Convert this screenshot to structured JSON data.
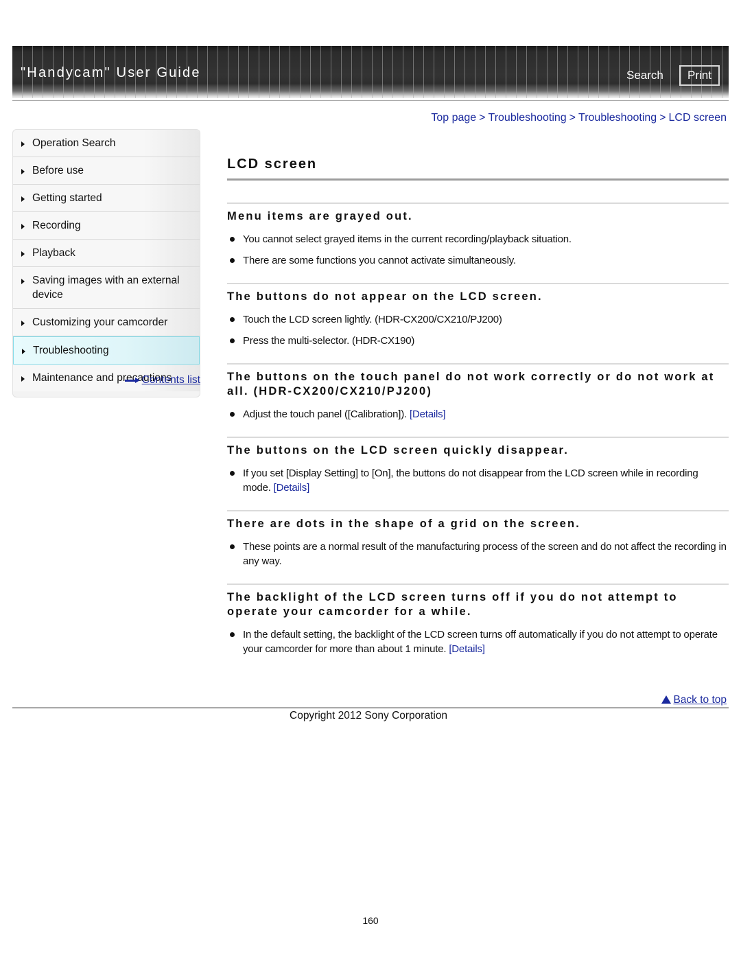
{
  "header": {
    "title": "\"Handycam\" User Guide",
    "search_label": "Search",
    "print_label": "Print"
  },
  "breadcrumb": [
    {
      "label": "Top page"
    },
    {
      "label": "Troubleshooting"
    },
    {
      "label": "Troubleshooting"
    },
    {
      "label": "LCD screen"
    }
  ],
  "breadcrumb_separator": ">",
  "sidebar": {
    "items": [
      {
        "label": "Operation Search",
        "active": false
      },
      {
        "label": "Before use",
        "active": false
      },
      {
        "label": "Getting started",
        "active": false
      },
      {
        "label": "Recording",
        "active": false
      },
      {
        "label": "Playback",
        "active": false
      },
      {
        "label": "Saving images with an external device",
        "active": false
      },
      {
        "label": "Customizing your camcorder",
        "active": false
      },
      {
        "label": "Troubleshooting",
        "active": true
      },
      {
        "label": "Maintenance and precautions",
        "active": false
      }
    ],
    "contents_link": "Contents list"
  },
  "main": {
    "title": "LCD screen",
    "sections": [
      {
        "heading": "Menu items are grayed out.",
        "bullets": [
          {
            "text": "You cannot select grayed items in the current recording/playback situation.",
            "link": ""
          },
          {
            "text": "There are some functions you cannot activate simultaneously.",
            "link": ""
          }
        ]
      },
      {
        "heading": "The buttons do not appear on the LCD screen.",
        "bullets": [
          {
            "text": "Touch the LCD screen lightly. (HDR-CX200/CX210/PJ200)",
            "link": ""
          },
          {
            "text": "Press the multi-selector. (HDR-CX190)",
            "link": ""
          }
        ]
      },
      {
        "heading": "The buttons on the touch panel do not work correctly or do not work at all. (HDR-CX200/CX210/PJ200)",
        "bullets": [
          {
            "text": "Adjust the touch panel ([Calibration]).",
            "link": "[Details]"
          }
        ]
      },
      {
        "heading": "The buttons on the LCD screen quickly disappear.",
        "bullets": [
          {
            "text": "If you set [Display Setting] to [On], the buttons do not disappear from the LCD screen while in recording mode.",
            "link": "[Details]"
          }
        ]
      },
      {
        "heading": "There are dots in the shape of a grid on the screen.",
        "bullets": [
          {
            "text": "These points are a normal result of the manufacturing process of the screen and do not affect the recording in any way.",
            "link": ""
          }
        ]
      },
      {
        "heading": "The backlight of the LCD screen turns off if you do not attempt to operate your camcorder for a while.",
        "bullets": [
          {
            "text": "In the default setting, the backlight of the LCD screen turns off automatically if you do not attempt to operate your camcorder for more than about 1 minute.",
            "link": "[Details]"
          }
        ]
      }
    ]
  },
  "back_to_top": "Back to top",
  "footer": {
    "copyright": "Copyright 2012 Sony Corporation",
    "page_number": "160"
  },
  "colors": {
    "link": "#1b2a9e",
    "active_nav_border": "#86dbe8",
    "active_nav_bg": "#e8fbfd"
  }
}
